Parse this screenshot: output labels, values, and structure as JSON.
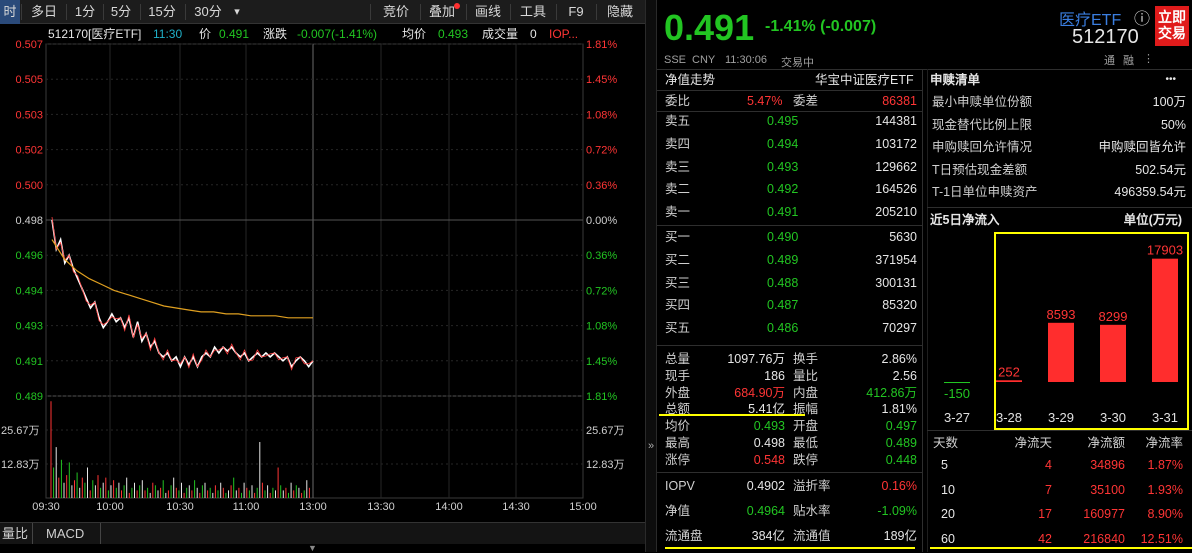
{
  "toolbar": {
    "left_tabs": [
      "时",
      "多日",
      "1分",
      "5分",
      "15分",
      "30分"
    ],
    "dropdown": "▾",
    "right_tabs": [
      "竞价",
      "叠加",
      "画线",
      "工具",
      "F9",
      "隐藏"
    ]
  },
  "infobar": {
    "code_name": "512170[医疗ETF]",
    "time": "11:30",
    "price_label": "价",
    "price": "0.491",
    "change_label": "涨跌",
    "change": "-0.007(-1.41%)",
    "avg_label": "均价",
    "avg": "0.493",
    "vol_label": "成交量",
    "vol": "0",
    "iopv": "IOP..."
  },
  "intraday": {
    "price_ticks": [
      "0.507",
      "0.505",
      "0.503",
      "0.502",
      "0.500",
      "0.498",
      "0.496",
      "0.494",
      "0.493",
      "0.491",
      "0.489"
    ],
    "pct_ticks": [
      "1.81%",
      "1.45%",
      "1.08%",
      "0.72%",
      "0.36%",
      "0.00%",
      "0.36%",
      "0.72%",
      "1.08%",
      "1.45%",
      "1.81%"
    ],
    "vol_ticks": [
      "25.67万",
      "12.83万"
    ],
    "time_ticks": [
      "09:30",
      "10:00",
      "10:30",
      "11:00",
      "13:00",
      "13:30",
      "14:00",
      "14:30",
      "15:00"
    ],
    "prev_close": 0.498,
    "price_range": [
      0.489,
      0.507
    ],
    "volume_max": 38.5,
    "price_series": [
      0.498,
      0.4965,
      0.497,
      0.4958,
      0.4962,
      0.4955,
      0.495,
      0.4945,
      0.494,
      0.4935,
      0.4938,
      0.493,
      0.4925,
      0.4928,
      0.4932,
      0.4928,
      0.493,
      0.4925,
      0.493,
      0.492,
      0.4928,
      0.4918,
      0.4922,
      0.4915,
      0.4918,
      0.4912,
      0.491,
      0.4912,
      0.4908,
      0.491,
      0.4905,
      0.491,
      0.4906,
      0.491,
      0.4905,
      0.491,
      0.4912,
      0.491,
      0.4915,
      0.4912,
      0.4915,
      0.4913,
      0.4915,
      0.4912,
      0.491,
      0.4912,
      0.4908,
      0.491,
      0.4912,
      0.491,
      0.4912,
      0.491,
      0.4912,
      0.491,
      0.4908,
      0.491,
      0.4905,
      0.4908,
      0.491,
      0.4908,
      0.4905,
      0.4908
    ],
    "avg_series": [
      0.497,
      0.496,
      0.4954,
      0.495,
      0.4947,
      0.4944,
      0.4942,
      0.494,
      0.4938,
      0.4936,
      0.4935,
      0.4934,
      0.4933,
      0.4933,
      0.4932,
      0.4932,
      0.4931,
      0.4931,
      0.4931,
      0.493,
      0.493,
      0.493
    ],
    "volumes": [
      38,
      12,
      20,
      8,
      15,
      6,
      9,
      14,
      5,
      7,
      10,
      4,
      8,
      6,
      12,
      3,
      7,
      5,
      9,
      4,
      6,
      8,
      3,
      5,
      7,
      4,
      6,
      3,
      5,
      8,
      2,
      4,
      6,
      3,
      5,
      7,
      3,
      4,
      2,
      6,
      5,
      3,
      4,
      7,
      2,
      3,
      5,
      8,
      4,
      3,
      6,
      2,
      4,
      5,
      3,
      7,
      4,
      2,
      5,
      6,
      3,
      4,
      2,
      5,
      3,
      6,
      4,
      2,
      3,
      5,
      8,
      3,
      4,
      2,
      6,
      4,
      3,
      5,
      2,
      4,
      22,
      6,
      3,
      5,
      2,
      4,
      3,
      12,
      5,
      3,
      4,
      2,
      6,
      3,
      5,
      4,
      2,
      3,
      7,
      4
    ]
  },
  "bottombar": {
    "tabs": [
      "量比",
      "MACD"
    ]
  },
  "header": {
    "price": "0.491",
    "change": "-1.41% (-0.007)",
    "name": "医疗ETF",
    "info_icon": "ⓘ",
    "code": "512170",
    "button": "立即交易",
    "market": "SSE",
    "currency": "CNY",
    "datetime": "11:30:06",
    "status": "交易中",
    "badges": [
      "通",
      "融",
      "⋮"
    ]
  },
  "orderbook": {
    "title": "净值走势",
    "fund_name": "华宝中证医疗ETF",
    "weibi_label": "委比",
    "weibi": "5.47%",
    "weicha_label": "委差",
    "weicha": "86381",
    "asks": [
      {
        "label": "卖五",
        "price": "0.495",
        "vol": "144381"
      },
      {
        "label": "卖四",
        "price": "0.494",
        "vol": "103172"
      },
      {
        "label": "卖三",
        "price": "0.493",
        "vol": "129662"
      },
      {
        "label": "卖二",
        "price": "0.492",
        "vol": "164526"
      },
      {
        "label": "卖一",
        "price": "0.491",
        "vol": "205210"
      }
    ],
    "bids": [
      {
        "label": "买一",
        "price": "0.490",
        "vol": "5630"
      },
      {
        "label": "买二",
        "price": "0.489",
        "vol": "371954"
      },
      {
        "label": "买三",
        "price": "0.488",
        "vol": "300131"
      },
      {
        "label": "买四",
        "price": "0.487",
        "vol": "85320"
      },
      {
        "label": "买五",
        "price": "0.486",
        "vol": "70297"
      }
    ]
  },
  "stats": [
    [
      {
        "l": "总量",
        "v": "1097.76万",
        "c": "wht"
      },
      {
        "l": "换手",
        "v": "2.86%",
        "c": "wht"
      }
    ],
    [
      {
        "l": "现手",
        "v": "186",
        "c": "wht"
      },
      {
        "l": "量比",
        "v": "2.56",
        "c": "wht"
      }
    ],
    [
      {
        "l": "外盘",
        "v": "684.90万",
        "c": "red"
      },
      {
        "l": "内盘",
        "v": "412.86万",
        "c": "grn"
      }
    ],
    [
      {
        "l": "总额",
        "v": "5.41亿",
        "c": "wht"
      },
      {
        "l": "振幅",
        "v": "1.81%",
        "c": "wht"
      }
    ],
    [
      {
        "l": "均价",
        "v": "0.493",
        "c": "grn"
      },
      {
        "l": "开盘",
        "v": "0.497",
        "c": "grn"
      }
    ],
    [
      {
        "l": "最高",
        "v": "0.498",
        "c": "wht"
      },
      {
        "l": "最低",
        "v": "0.489",
        "c": "grn"
      }
    ],
    [
      {
        "l": "涨停",
        "v": "0.548",
        "c": "red"
      },
      {
        "l": "跌停",
        "v": "0.448",
        "c": "grn"
      }
    ]
  ],
  "etfinfo": [
    [
      {
        "l": "IOPV",
        "v": "0.4902",
        "c": "wht"
      },
      {
        "l": "溢折率",
        "v": "0.16%",
        "c": "red"
      }
    ],
    [
      {
        "l": "净值",
        "v": "0.4964",
        "c": "grn"
      },
      {
        "l": "贴水率",
        "v": "-1.09%",
        "c": "grn"
      }
    ],
    [
      {
        "l": "流通盘",
        "v": "384亿",
        "c": "wht"
      },
      {
        "l": "流通值",
        "v": "189亿",
        "c": "wht"
      }
    ]
  ],
  "redeem": {
    "title": "申赎清单",
    "more": "•••",
    "rows": [
      {
        "l": "最小申赎单位份额",
        "v": "100万"
      },
      {
        "l": "现金替代比例上限",
        "v": "50%"
      },
      {
        "l": "申购赎回允许情况",
        "v": "申购赎回皆允许"
      },
      {
        "l": "T日预估现金差额",
        "v": "502.54元"
      },
      {
        "l": "T-1日单位申赎资产",
        "v": "496359.54元"
      }
    ]
  },
  "netflow": {
    "title": "近5日净流入",
    "unit": "单位(万元)",
    "chart_data": {
      "type": "bar",
      "categories": [
        "3-27",
        "3-28",
        "3-29",
        "3-30",
        "3-31"
      ],
      "values": [
        -150,
        252,
        8593,
        8299,
        17903
      ],
      "value_labels": [
        "-150",
        "252",
        "8593",
        "8299",
        "17903"
      ],
      "ylim": [
        -200,
        18000
      ],
      "colors": {
        "positive": "#ff2d2d",
        "negative": "#22c522"
      }
    }
  },
  "flowtable": {
    "headers": [
      "天数",
      "净流天",
      "净流额",
      "净流率"
    ],
    "rows": [
      [
        "5",
        "4",
        "34896",
        "1.87%"
      ],
      [
        "10",
        "7",
        "35100",
        "1.93%"
      ],
      [
        "20",
        "17",
        "160977",
        "8.90%"
      ],
      [
        "60",
        "42",
        "216840",
        "12.51%"
      ]
    ]
  },
  "colors": {
    "up": "#ff3535",
    "down": "#22c522",
    "avg_line": "#e0a020",
    "highlight": "#ffff00"
  }
}
